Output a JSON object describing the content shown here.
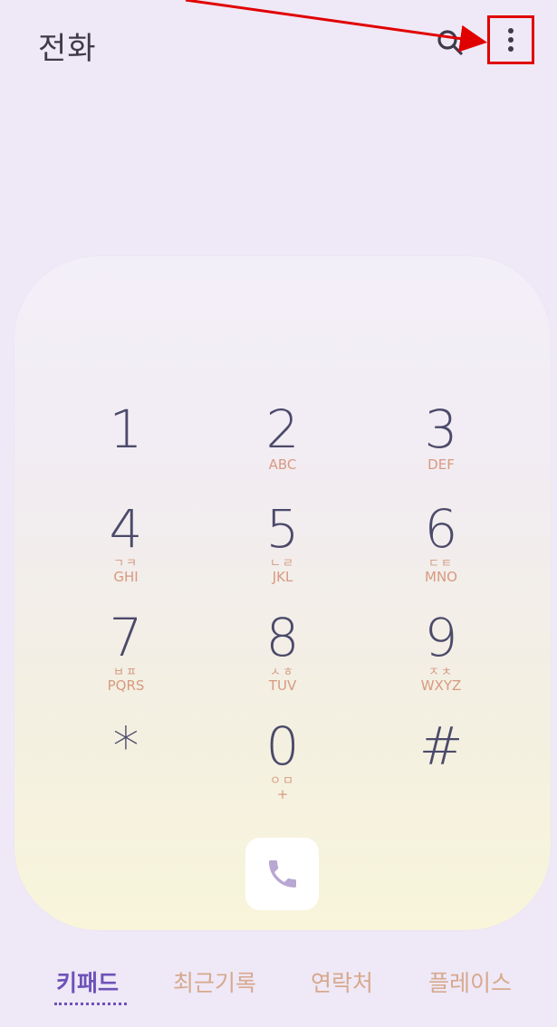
{
  "header": {
    "title": "전화",
    "search_icon": "search-icon",
    "more_icon": "more-options-icon"
  },
  "dialpad": {
    "keys": [
      {
        "digit": "1",
        "kor": "",
        "eng": ""
      },
      {
        "digit": "2",
        "kor": "",
        "eng": "ABC"
      },
      {
        "digit": "3",
        "kor": "",
        "eng": "DEF"
      },
      {
        "digit": "4",
        "kor": "ㄱㅋ",
        "eng": "GHI"
      },
      {
        "digit": "5",
        "kor": "ㄴㄹ",
        "eng": "JKL"
      },
      {
        "digit": "6",
        "kor": "ㄷㅌ",
        "eng": "MNO"
      },
      {
        "digit": "7",
        "kor": "ㅂㅍ",
        "eng": "PQRS"
      },
      {
        "digit": "8",
        "kor": "ㅅㅎ",
        "eng": "TUV"
      },
      {
        "digit": "9",
        "kor": "ㅈㅊ",
        "eng": "WXYZ"
      },
      {
        "digit": "*",
        "kor": "",
        "eng": ""
      },
      {
        "digit": "0",
        "kor": "ㅇㅁ",
        "eng": "+"
      },
      {
        "digit": "#",
        "kor": "",
        "eng": ""
      }
    ],
    "call_icon": "phone-icon"
  },
  "tabs": [
    {
      "label": "키패드",
      "active": true
    },
    {
      "label": "최근기록",
      "active": false
    },
    {
      "label": "연락처",
      "active": false
    },
    {
      "label": "플레이스",
      "active": false
    }
  ],
  "colors": {
    "accent": "#6d52b8",
    "highlight_box": "#e00000",
    "letters": "#d89a80",
    "digits": "#4b4a6a"
  }
}
